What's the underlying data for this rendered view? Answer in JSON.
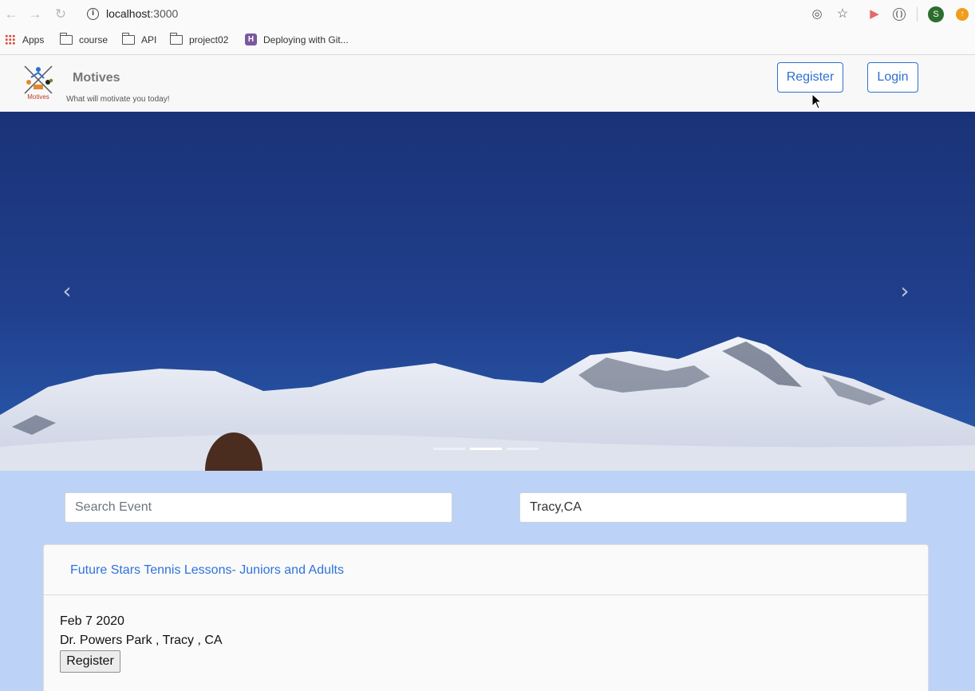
{
  "browser": {
    "url_host": "localhost",
    "url_port": ":3000",
    "profile_initial": "S",
    "bookmarks": [
      {
        "label": "Apps",
        "icon": "apps-grid-icon"
      },
      {
        "label": "course",
        "icon": "folder-icon"
      },
      {
        "label": "API",
        "icon": "folder-icon"
      },
      {
        "label": "project02",
        "icon": "folder-icon"
      },
      {
        "label": "Deploying with Git...",
        "icon": "heroku-icon"
      }
    ]
  },
  "navbar": {
    "logo_text": "Motives",
    "brand": "Motives",
    "tagline": "What will motivate you today!",
    "register_label": "Register",
    "login_label": "Login"
  },
  "carousel": {
    "prev_icon": "chevron-left-icon",
    "next_icon": "chevron-right-icon",
    "slide_count": 3,
    "active_slide": 2
  },
  "search": {
    "event_placeholder": "Search Event",
    "event_value": "",
    "city_value": "Tracy,CA"
  },
  "events": [
    {
      "title": "Future Stars Tennis Lessons- Juniors and Adults",
      "date": "Feb 7 2020",
      "location": "Dr. Powers Park , Tracy , CA",
      "register_label": "Register"
    }
  ],
  "colors": {
    "accent": "#2f6fd1",
    "page_background": "#bcd2f6",
    "hero_sky": "#1d3a80"
  }
}
